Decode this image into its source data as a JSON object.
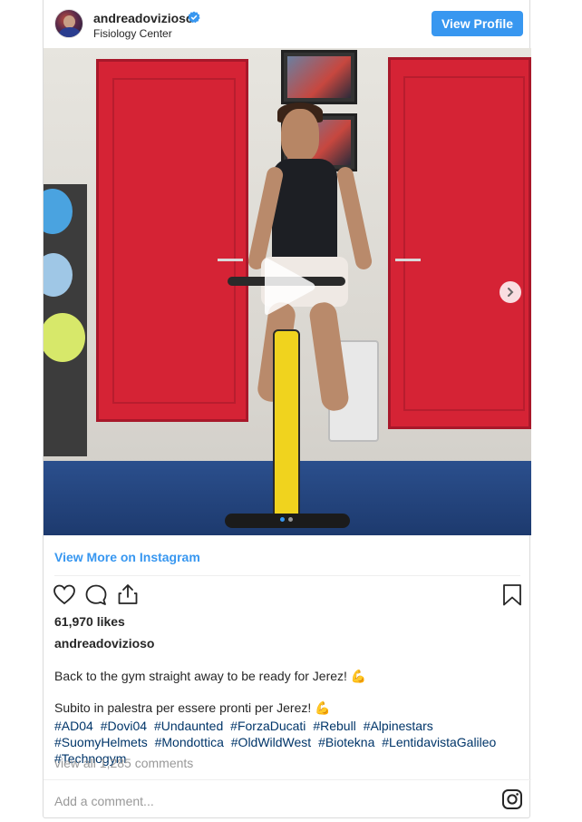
{
  "header": {
    "username": "andreadovizioso",
    "location": "Fisiology Center",
    "view_profile_label": "View Profile"
  },
  "media": {
    "carousel_total": 2,
    "carousel_active": 1
  },
  "view_more_label": "View More on Instagram",
  "likes_text": "61,970 likes",
  "caption": {
    "owner": "andreadovizioso",
    "line1": "Back to the gym straight away to be ready for Jerez! 💪",
    "line2": "Subito in palestra per essere pronti per Jerez! 💪",
    "hashtags": [
      "#AD04",
      "#Dovi04",
      "#Undaunted",
      "#ForzaDucati",
      "#Rebull",
      "#Alpinestars",
      "#SuomyHelmets",
      "#Mondottica",
      "#OldWildWest",
      "#Biotekna",
      "#LentidavistaGalileo",
      "#Technogym"
    ]
  },
  "comments_link": "view all 1,285 comments",
  "add_comment_placeholder": "Add a comment...",
  "colors": {
    "accent": "#3897f0",
    "hashtag": "#003569",
    "muted": "#999999"
  },
  "icons": [
    "verified-badge-icon",
    "heart-icon",
    "comment-icon",
    "share-icon",
    "bookmark-icon",
    "play-icon",
    "next-arrow-icon",
    "instagram-icon"
  ]
}
